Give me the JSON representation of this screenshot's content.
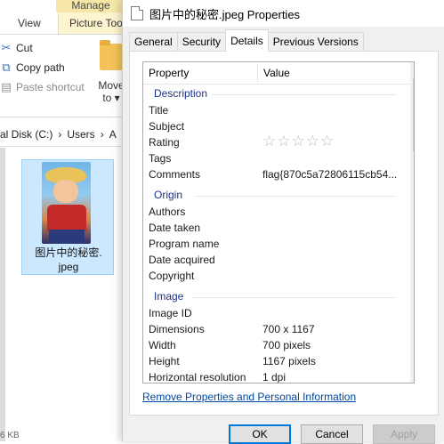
{
  "explorer": {
    "ribbon_context_tab": "Manage",
    "tabs": {
      "view": "View",
      "picture_tools": "Picture Tools"
    },
    "actions": {
      "cut": "Cut",
      "copy_path": "Copy path",
      "paste_shortcut": "Paste shortcut",
      "move_line1": "Move",
      "move_line2": "to ▾"
    },
    "breadcrumb": [
      "al Disk (C:)",
      "›",
      "Users",
      "›",
      "A"
    ],
    "file": {
      "name_line1": "图片中的秘密.",
      "name_line2": "jpeg"
    },
    "status_text": "6 KB"
  },
  "dialog": {
    "title": "图片中的秘密.jpeg Properties",
    "tabs": [
      "General",
      "Security",
      "Details",
      "Previous Versions"
    ],
    "columns": {
      "property": "Property",
      "value": "Value"
    },
    "groups": {
      "description": "Description",
      "origin": "Origin",
      "image": "Image"
    },
    "rows": {
      "title": {
        "k": "Title",
        "v": ""
      },
      "subject": {
        "k": "Subject",
        "v": ""
      },
      "rating": {
        "k": "Rating",
        "stars": "☆☆☆☆☆"
      },
      "tags": {
        "k": "Tags",
        "v": ""
      },
      "comments": {
        "k": "Comments",
        "v": "flag{870c5a72806115cb54..."
      },
      "authors": {
        "k": "Authors",
        "v": ""
      },
      "date_taken": {
        "k": "Date taken",
        "v": ""
      },
      "program_name": {
        "k": "Program name",
        "v": ""
      },
      "date_acquired": {
        "k": "Date acquired",
        "v": ""
      },
      "copyright": {
        "k": "Copyright",
        "v": ""
      },
      "image_id": {
        "k": "Image ID",
        "v": ""
      },
      "dimensions": {
        "k": "Dimensions",
        "v": "700 x 1167"
      },
      "width": {
        "k": "Width",
        "v": "700 pixels"
      },
      "height": {
        "k": "Height",
        "v": "1167 pixels"
      },
      "horizontal_resolution": {
        "k": "Horizontal resolution",
        "v": "1 dpi"
      }
    },
    "remove_link": "Remove Properties and Personal Information",
    "buttons": {
      "ok": "OK",
      "cancel": "Cancel",
      "apply": "Apply"
    }
  }
}
